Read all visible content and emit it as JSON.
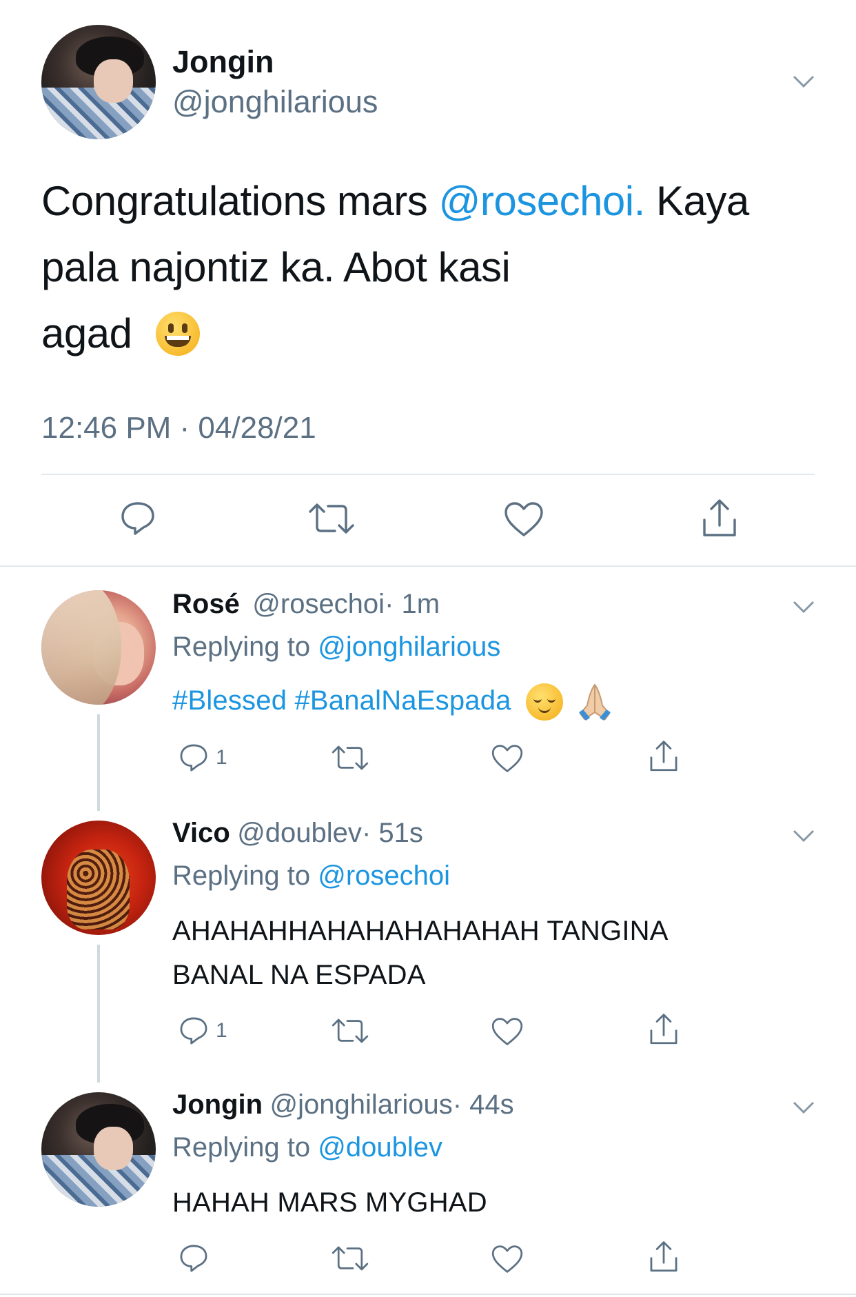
{
  "main_tweet": {
    "name": "Jongin",
    "handle": "@jonghilarious",
    "text_before": "Congratulations mars ",
    "mention": "@rosechoi.",
    "text_after_line1": " Kaya",
    "text_line2": "pala najontiz ka. Abot kasi",
    "text_line3": "agad",
    "emoji": "grinning-face",
    "timestamp": "12:46 PM · 04/28/21",
    "avatar_icon": "avatar-jongin"
  },
  "replies": [
    {
      "name": "Rosé",
      "handle": "@rosechoi",
      "time": "· 1m",
      "replying_label": "Replying to ",
      "replying_to": "@jonghilarious",
      "hashtags": "#Blessed #BanalNaEspada",
      "emojis": [
        "relieved-face",
        "folded-hands"
      ],
      "reply_count": "1"
    },
    {
      "name": "Vico",
      "handle": "@doublev",
      "time": "· 51s",
      "replying_label": "Replying to ",
      "replying_to": "@rosechoi",
      "text_line1": "AHAHAHHAHAHAHAHAHAH TANGINA",
      "text_line2": "BANAL NA ESPADA",
      "reply_count": "1"
    },
    {
      "name": "Jongin",
      "handle": "@jonghilarious",
      "time": "· 44s",
      "replying_label": "Replying to ",
      "replying_to": "@doublev",
      "text_line1": "HAHAH MARS MYGHAD",
      "reply_count": ""
    }
  ],
  "colors": {
    "link": "#1b95e0",
    "secondary": "#5b7083",
    "divider": "#e1e8ed"
  }
}
